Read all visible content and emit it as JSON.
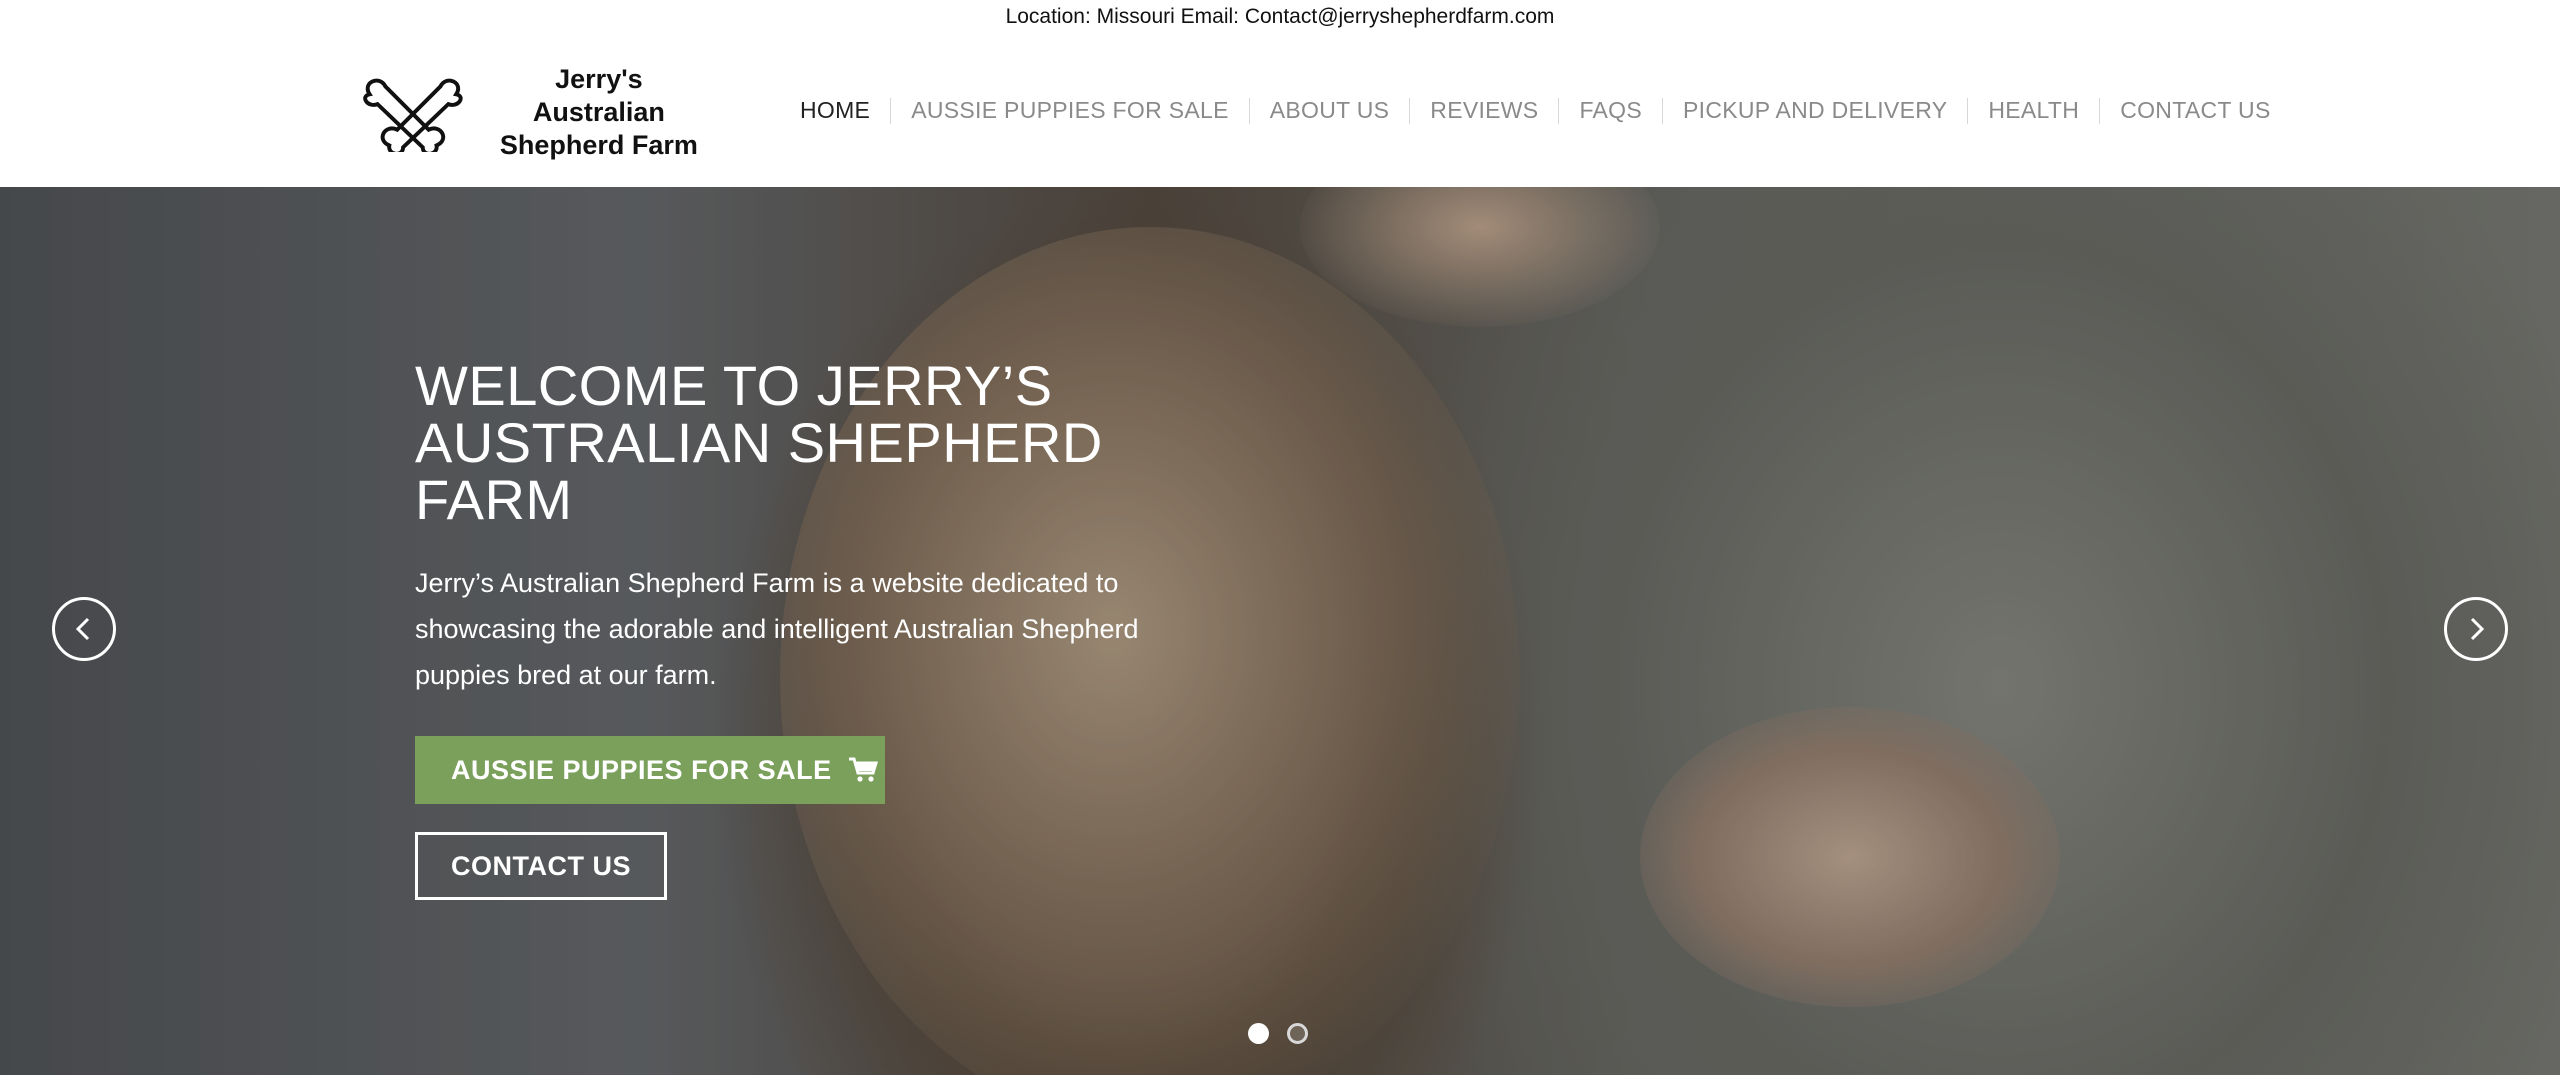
{
  "topbar": {
    "text": "Location: Missouri Email: Contact@jerryshepherdfarm.com"
  },
  "logo": {
    "line1": "Jerry's Australian",
    "line2": "Shepherd Farm",
    "icon": "bones-logo-icon"
  },
  "nav": {
    "items": [
      {
        "label": "HOME",
        "active": true
      },
      {
        "label": "AUSSIE PUPPIES FOR SALE",
        "active": false
      },
      {
        "label": "ABOUT US",
        "active": false
      },
      {
        "label": "REVIEWS",
        "active": false
      },
      {
        "label": "FAQS",
        "active": false
      },
      {
        "label": "PICKUP AND DELIVERY",
        "active": false
      },
      {
        "label": "HEALTH",
        "active": false
      },
      {
        "label": "CONTACT US",
        "active": false
      }
    ]
  },
  "hero": {
    "title": "WELCOME TO JERRY’S AUSTRALIAN SHEPHERD FARM",
    "text": "Jerry’s Australian Shepherd Farm is a website dedicated to showcasing the adorable and intelligent Australian Shepherd puppies bred at our farm.",
    "primary_button": "AUSSIE PUPPIES FOR SALE",
    "secondary_button": "CONTACT US",
    "slides": 2,
    "active_slide": 1
  },
  "colors": {
    "accent_green": "#7aa05c",
    "nav_active": "#222222",
    "nav_inactive": "#8a8a8a"
  }
}
